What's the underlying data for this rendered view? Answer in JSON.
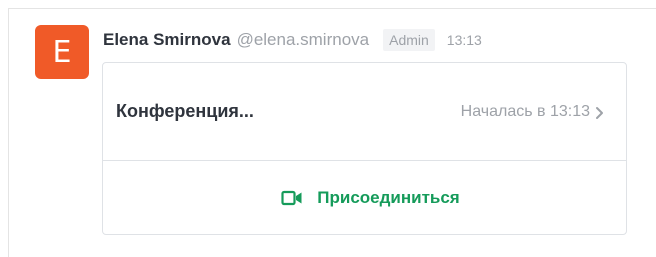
{
  "message": {
    "avatar_letter": "E",
    "avatar_color": "#f05a28",
    "author_name": "Elena Smirnova",
    "username": "@elena.smirnova",
    "role_badge": "Admin",
    "timestamp": "13:13"
  },
  "video_call": {
    "title": "Конференция...",
    "status": "Началась в 13:13",
    "status_icon": "chevron-right-icon",
    "join_label": "Присоединиться",
    "join_icon": "video-camera-icon",
    "accent_color": "#159b5a"
  }
}
